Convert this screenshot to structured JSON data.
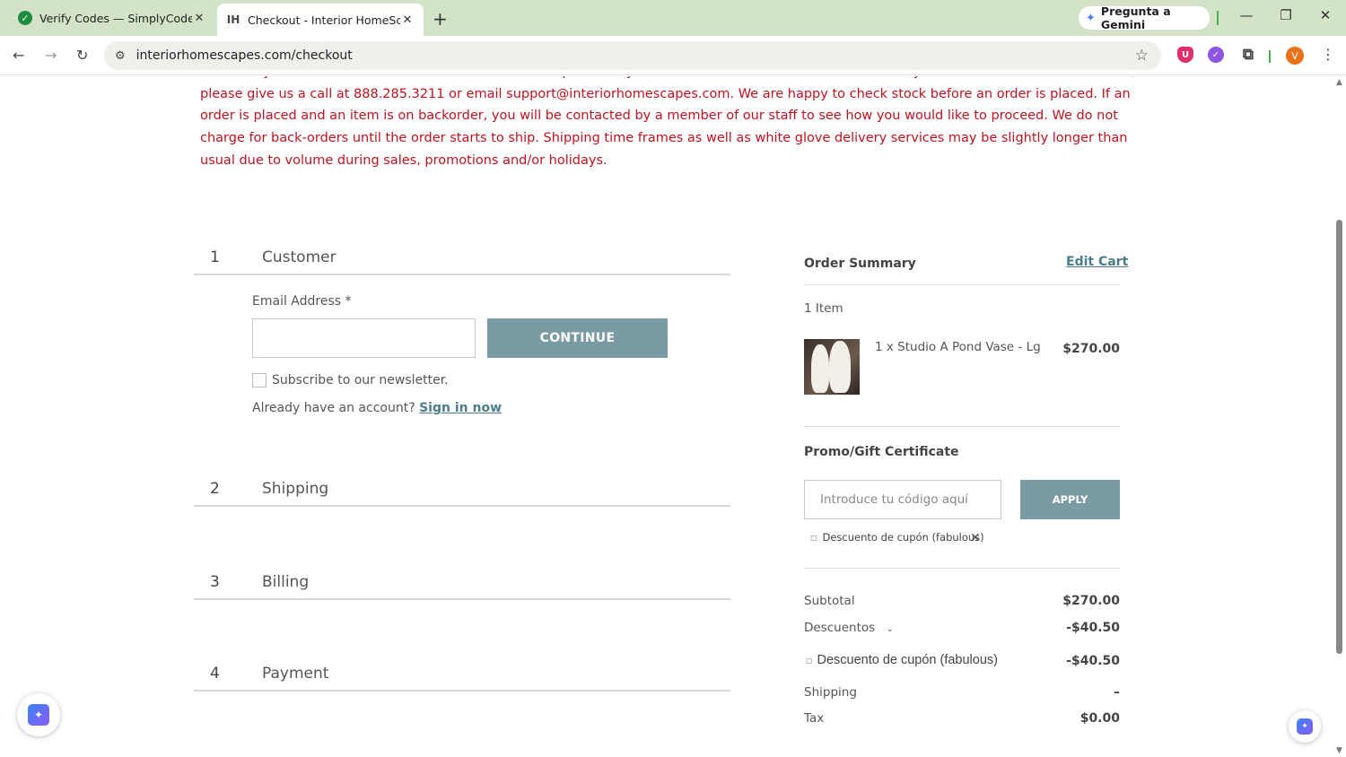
{
  "browser": {
    "tabs": [
      {
        "title": "Verify Codes — SimplyCodes",
        "favicon": "simplycodes-icon"
      },
      {
        "title": "Checkout - Interior HomeScapes",
        "favicon": "IH"
      }
    ],
    "gemini_label": "Pregunta a Gemini",
    "url": "interiorhomescapes.com/checkout",
    "profile_initial": "V"
  },
  "notice": {
    "text": "Availability of an item is not confirmed until an order is placed. If you would like to check stock on an item or you are worried it is not available, please give us a call at 888.285.3211 or email support@interiorhomescapes.com. We are happy to check stock before an order is placed. If an order is placed and an item is on backorder, you will be contacted by a member of our staff to see how you would like to proceed. We do not charge for back-orders until the order starts to ship. Shipping time frames as well as white glove delivery services may be slightly longer than usual due to volume during sales, promotions and/or holidays."
  },
  "steps": [
    {
      "num": "1",
      "title": "Customer"
    },
    {
      "num": "2",
      "title": "Shipping"
    },
    {
      "num": "3",
      "title": "Billing"
    },
    {
      "num": "4",
      "title": "Payment"
    }
  ],
  "customer": {
    "email_label": "Email Address",
    "required_mark": "*",
    "email_value": "",
    "continue_label": "CONTINUE",
    "newsletter_label": "Subscribe to our newsletter.",
    "account_prompt": "Already have an account?",
    "sign_in_label": "Sign in now"
  },
  "summary": {
    "title": "Order Summary",
    "edit_cart": "Edit Cart",
    "item_count": "1 Item",
    "item_name": "1 x Studio A Pond Vase - Lg",
    "item_price": "$270.00",
    "promo_title": "Promo/Gift Certificate",
    "promo_placeholder": "Introduce tu código aquí",
    "apply_label": "APPLY",
    "applied_coupon": "Descuento de cupón (fabulous)",
    "subtotal_label": "Subtotal",
    "subtotal_value": "$270.00",
    "discounts_label": "Descuentos",
    "discounts_value": "-$40.50",
    "coupon_line_label": "Descuento de cupón (fabulous)",
    "coupon_line_value": "-$40.50",
    "shipping_label": "Shipping",
    "shipping_value": "–",
    "tax_label": "Tax",
    "tax_value": "$0.00"
  },
  "colors": {
    "notice_red": "#c1121f",
    "button_teal": "#7a9aa4",
    "link_teal": "#4b7d8c",
    "tabbar_green": "#d3e3c7"
  }
}
